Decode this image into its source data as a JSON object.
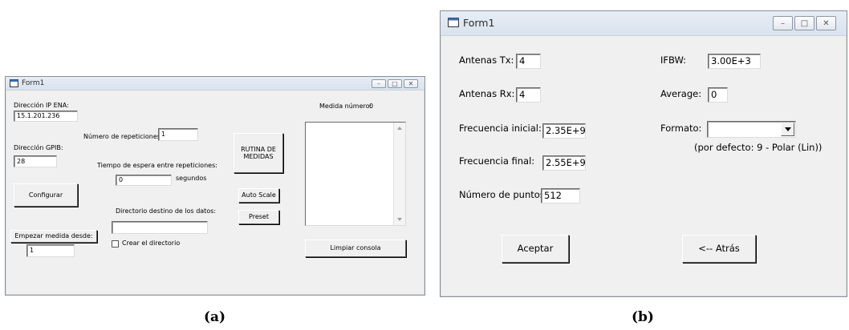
{
  "form_a": {
    "title": "Form1",
    "controls": {
      "minimize": "–",
      "maximize": "□",
      "close": "✕"
    },
    "ip_label": "Dirección IP ENA:",
    "ip_value": "15.1.201.236",
    "medida_numero_label": "Medida número:",
    "medida_numero_value": "0",
    "repeticiones_label": "Número de repeticiones:",
    "repeticiones_value": "1",
    "gpib_label": "Dirección GPIB:",
    "gpib_value": "28",
    "rutina_button": "RUTINA DE\nMEDIDAS",
    "tiempo_label": "Tiempo de espera entre repeticiones:",
    "tiempo_value": "0",
    "segundos_label": "segundos",
    "configurar_button": "Configurar",
    "auto_scale_button": "Auto Scale",
    "directorio_label": "Directorio destino de los datos:",
    "directorio_value": "",
    "preset_button": "Preset",
    "empezar_button": "Empezar medida desde:",
    "empezar_value": "1",
    "crear_directorio_label": "Crear el directorio",
    "crear_directorio_checked": false,
    "limpiar_button": "Limpiar consola",
    "console_lines": []
  },
  "form_b": {
    "title": "Form1",
    "controls": {
      "minimize": "–",
      "maximize": "□",
      "close": "✕"
    },
    "antenas_tx_label": "Antenas Tx:",
    "antenas_tx_value": "4",
    "ifbw_label": "IFBW:",
    "ifbw_value": "3.00E+3",
    "antenas_rx_label": "Antenas Rx:",
    "antenas_rx_value": "4",
    "average_label": "Average:",
    "average_value": "0",
    "freq_inicial_label": "Frecuencia inicial:",
    "freq_inicial_value": "2.35E+9",
    "formato_label": "Formato:",
    "formato_value": "",
    "formato_hint": "(por defecto: 9 - Polar (Lin))",
    "freq_final_label": "Frecuencia final:",
    "freq_final_value": "2.55E+9",
    "num_puntos_label": "Número de puntos",
    "num_puntos_value": "512",
    "aceptar_button": "Aceptar",
    "atras_button": "<-- Atrás"
  },
  "captions": {
    "a": "(a)",
    "b": "(b)"
  }
}
